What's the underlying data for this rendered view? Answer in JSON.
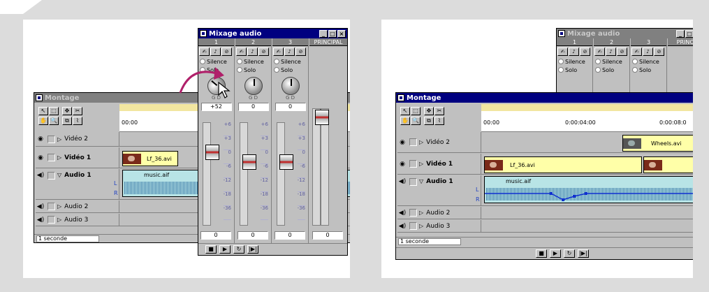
{
  "left": {
    "montage": {
      "title": "Montage",
      "timecode_start": "00:00",
      "tracks": [
        {
          "name": "Vidéo 2"
        },
        {
          "name": "Vidéo 1",
          "clip": "Lf_36.avi"
        },
        {
          "name": "Audio 1",
          "clip": "music.aif",
          "channel_l": "L",
          "channel_r": "R"
        },
        {
          "name": "Audio 2"
        },
        {
          "name": "Audio 3"
        }
      ],
      "status": "1 seconde"
    },
    "mixer": {
      "title": "Mixage audio",
      "channels": [
        {
          "num": "1",
          "silence": "Silence",
          "solo": "Solo",
          "value": "+52",
          "knob_letters": "G D",
          "fader_value": "0"
        },
        {
          "num": "2",
          "silence": "Silence",
          "solo": "Solo",
          "value": "0",
          "knob_letters": "G D",
          "fader_value": "0"
        },
        {
          "num": "3",
          "silence": "Silence",
          "solo": "Solo",
          "value": "0",
          "knob_letters": "G D",
          "fader_value": "0"
        }
      ],
      "master": {
        "label": "PRINCIPAL",
        "fader_value": "0"
      },
      "scale": [
        "+6",
        "+3",
        "0",
        "-6",
        "-12",
        "-18",
        "-36",
        "-∞"
      ]
    }
  },
  "right": {
    "montage": {
      "title": "Montage",
      "ruler": [
        "00:00",
        "0:00:04:00",
        "0:00:08:0"
      ],
      "tracks": [
        {
          "name": "Vidéo 2",
          "clip": "Wheels.avi"
        },
        {
          "name": "Vidéo 1",
          "clip": "Lf_36.avi"
        },
        {
          "name": "Audio 1",
          "clip": "music.aif",
          "channel_l": "L",
          "channel_r": "R"
        },
        {
          "name": "Audio 2"
        },
        {
          "name": "Audio 3"
        }
      ],
      "status": "1 seconde"
    },
    "mixer": {
      "title": "Mixage audio",
      "channels": [
        {
          "num": "1",
          "silence": "Silence",
          "solo": "Solo"
        },
        {
          "num": "2",
          "silence": "Silence",
          "solo": "Solo"
        },
        {
          "num": "3",
          "silence": "Silence",
          "solo": "Solo"
        }
      ],
      "master_label": "PRINCI"
    }
  },
  "colors": {
    "accent_arrow": "#b0206a",
    "clip_video": "#ffffa8",
    "clip_audio": "#b8e4e6",
    "title_active": "#000080"
  }
}
